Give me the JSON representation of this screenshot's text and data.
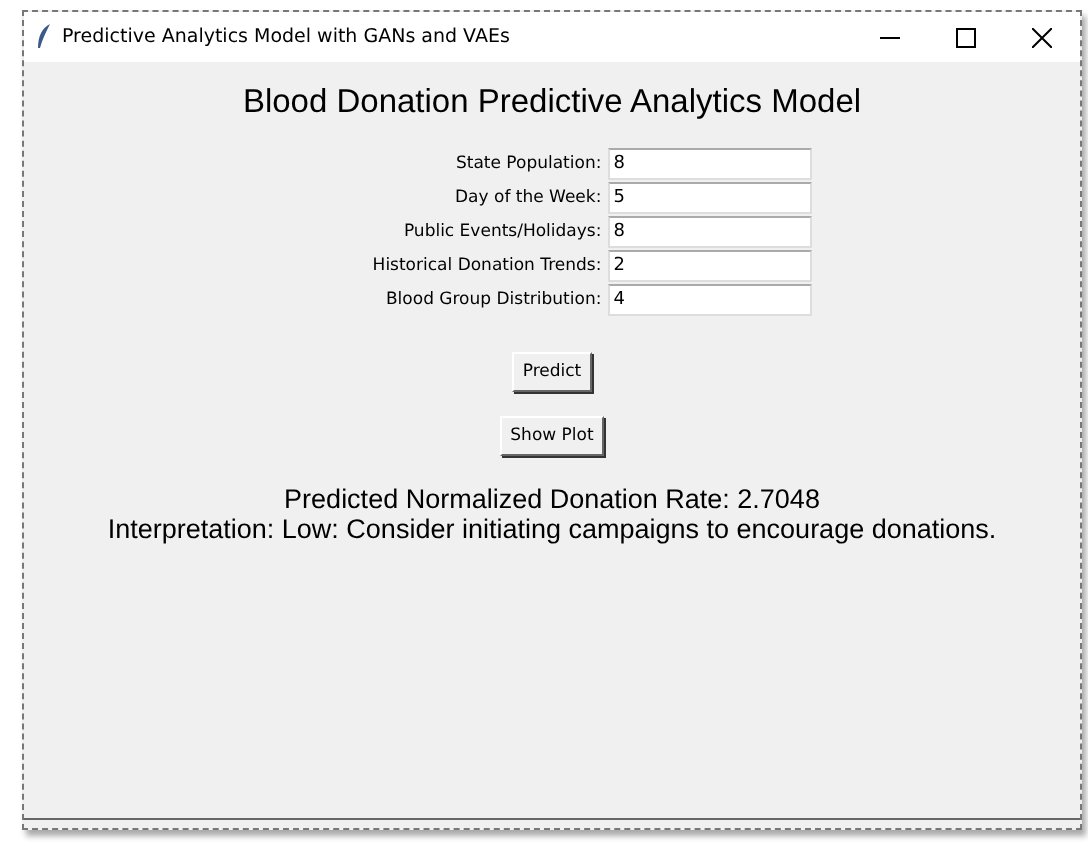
{
  "window": {
    "title": "Predictive Analytics Model with GANs and VAEs"
  },
  "heading": "Blood Donation Predictive Analytics Model",
  "fields": [
    {
      "label": "State Population:",
      "value": "8"
    },
    {
      "label": "Day of the Week:",
      "value": "5"
    },
    {
      "label": "Public Events/Holidays:",
      "value": "8"
    },
    {
      "label": "Historical Donation Trends:",
      "value": "2"
    },
    {
      "label": "Blood Group Distribution:",
      "value": "4"
    }
  ],
  "buttons": [
    "Predict",
    "Show Plot"
  ],
  "result": [
    "Predicted Normalized Donation Rate: 2.7048",
    "Interpretation: Low: Consider initiating campaigns to encourage donations."
  ]
}
